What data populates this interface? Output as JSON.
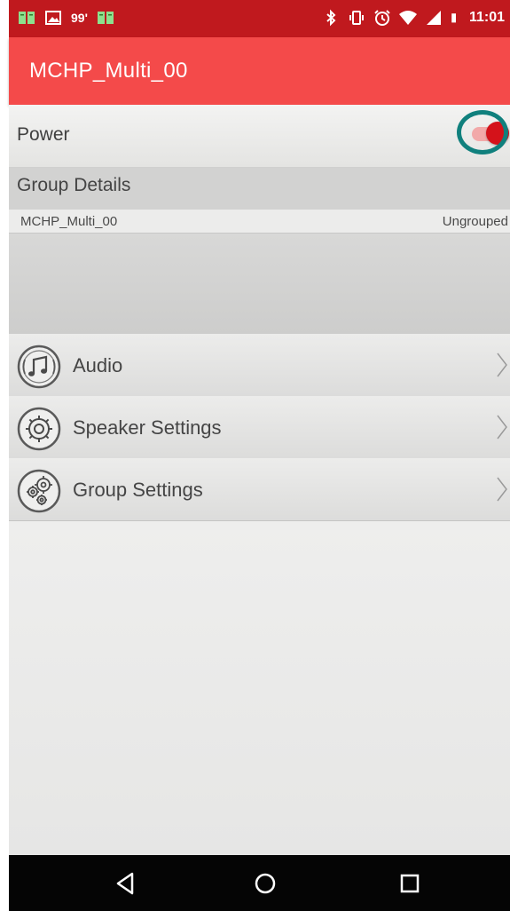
{
  "status_bar": {
    "left_icons": [
      "book-icon",
      "image-icon",
      "notification-count",
      "book-icon"
    ],
    "notification_count": "99'",
    "right_icons": [
      "bluetooth-icon",
      "vibrate-icon",
      "alarm-icon",
      "wifi-icon",
      "signal-icon",
      "battery-icon"
    ],
    "time": "11:01",
    "color": "#c0191e"
  },
  "app_bar": {
    "title": "MCHP_Multi_00",
    "color": "#f44a4a"
  },
  "power": {
    "label": "Power",
    "toggle_on": true,
    "accent_color": "#d4121a",
    "highlight_ring_color": "#10807d"
  },
  "group_details": {
    "header": "Group Details",
    "name": "MCHP_Multi_00",
    "status": "Ungrouped"
  },
  "menu": {
    "items": [
      {
        "label": "Audio",
        "icon": "music-icon"
      },
      {
        "label": "Speaker Settings",
        "icon": "gear-icon"
      },
      {
        "label": "Group Settings",
        "icon": "gears-icon"
      }
    ]
  },
  "nav_bar": {
    "buttons": [
      "back-icon",
      "home-icon",
      "recents-icon"
    ]
  }
}
